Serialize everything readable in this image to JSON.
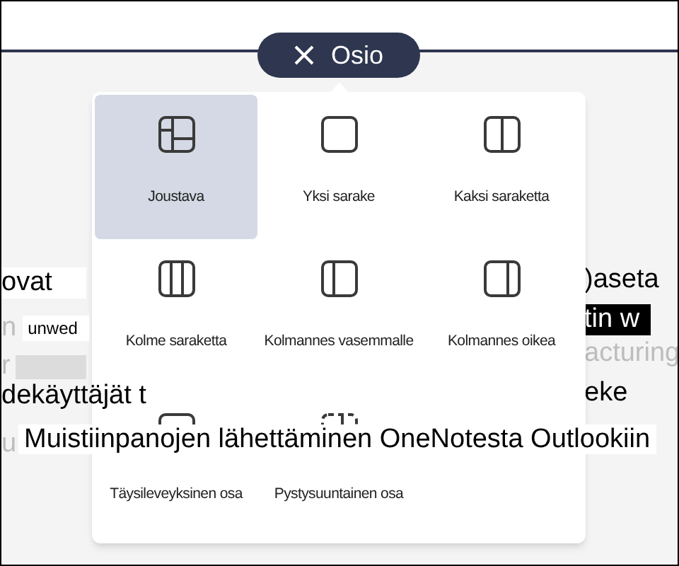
{
  "section_pill": {
    "label": "Osio"
  },
  "layouts": [
    {
      "label": "Joustava",
      "kind": "flexible",
      "selected": true
    },
    {
      "label": "Yksi sarake",
      "kind": "one",
      "selected": false
    },
    {
      "label": "Kaksi saraketta",
      "kind": "two",
      "selected": false
    },
    {
      "label": "Kolme saraketta",
      "kind": "three",
      "selected": false
    },
    {
      "label": "Kolmannes vasemmalle",
      "kind": "left_third",
      "selected": false
    },
    {
      "label": "Kolmannes oikea",
      "kind": "right_third",
      "selected": false
    },
    {
      "label": "Täysileveyksinen osa",
      "kind": "full_width",
      "selected": false
    },
    {
      "label": "Pystysuuntainen osa",
      "kind": "vertical",
      "selected": false
    }
  ],
  "left_fragments": [
    {
      "kind": "highlighted",
      "text": "ovat"
    },
    {
      "kind": "pair",
      "faded": "n",
      "boxed": "unwed"
    },
    {
      "kind": "bar",
      "faded": "r"
    },
    {
      "kind": "plain",
      "text": "dekäyttäjät t"
    },
    {
      "kind": "faded",
      "text": "u"
    }
  ],
  "right_fragments": [
    {
      "kind": "plain",
      "text": ")aseta"
    },
    {
      "kind": "inverted",
      "text": "tin w"
    },
    {
      "kind": "faded",
      "text": "acturing"
    },
    {
      "kind": "plain",
      "text": "eke"
    }
  ],
  "overlay_text": "Muistiinpanojen lähettäminen OneNotesta Outlookiin"
}
